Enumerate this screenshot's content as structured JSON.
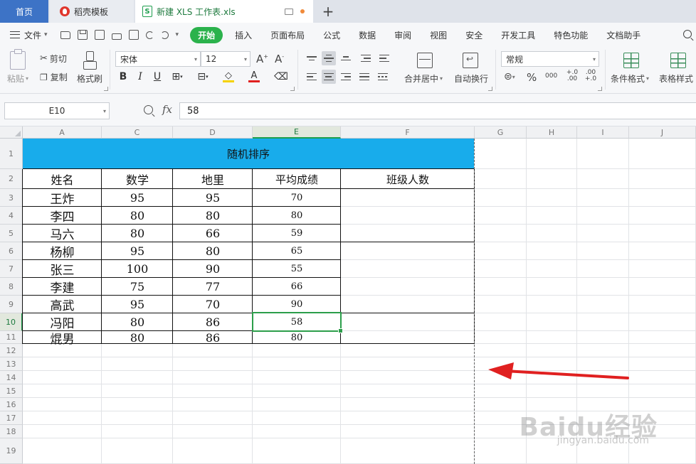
{
  "tabs": {
    "home": "首页",
    "template": "稻壳模板",
    "file": "新建 XLS 工作表.xls",
    "add": "+"
  },
  "menubar": {
    "file_menu": "文件",
    "items": [
      "开始",
      "插入",
      "页面布局",
      "公式",
      "数据",
      "审阅",
      "视图",
      "安全",
      "开发工具",
      "特色功能",
      "文档助手"
    ],
    "active": "开始"
  },
  "ribbon": {
    "paste": "粘贴",
    "cut": "剪切",
    "copy": "复制",
    "format_painter": "格式刷",
    "font_name": "宋体",
    "font_size": "12",
    "bold": "B",
    "italic": "I",
    "underline": "U",
    "merge_center": "合并居中",
    "wrap_text": "自动换行",
    "number_format": "常规",
    "percent": "%",
    "thousands": "000",
    "inc_decimal": "+.0 .00",
    "dec_decimal": ".00 +.0",
    "conditional_format": "条件格式",
    "table_style": "表格样式",
    "font_grow": "A+",
    "font_shrink": "A-"
  },
  "formula_bar": {
    "cell_ref": "E10",
    "fx": "fx",
    "value": "58"
  },
  "grid": {
    "columns": [
      "A",
      "C",
      "D",
      "E",
      "F",
      "G",
      "H",
      "I",
      "J"
    ],
    "rows": [
      "1",
      "2",
      "3",
      "4",
      "5",
      "6",
      "7",
      "8",
      "9",
      "10",
      "11",
      "12",
      "13",
      "14",
      "15",
      "16",
      "17",
      "18",
      "19"
    ],
    "active_column": "E",
    "active_row": "10"
  },
  "table": {
    "title": "随机排序",
    "headers": [
      "姓名",
      "数学",
      "地里",
      "平均成绩",
      "班级人数"
    ],
    "rows": [
      {
        "name": "王炸",
        "math": "95",
        "geo": "95",
        "avg": "70"
      },
      {
        "name": "李四",
        "math": "80",
        "geo": "80",
        "avg": "80"
      },
      {
        "name": "马六",
        "math": "80",
        "geo": "66",
        "avg": "59"
      },
      {
        "name": "杨柳",
        "math": "95",
        "geo": "80",
        "avg": "65"
      },
      {
        "name": "张三",
        "math": "100",
        "geo": "90",
        "avg": "55"
      },
      {
        "name": "李建",
        "math": "75",
        "geo": "77",
        "avg": "66"
      },
      {
        "name": "高武",
        "math": "95",
        "geo": "70",
        "avg": "90"
      },
      {
        "name": "冯阳",
        "math": "80",
        "geo": "86",
        "avg": "58"
      },
      {
        "name": "焜男",
        "math": "80",
        "geo": "86",
        "avg": "80"
      }
    ]
  },
  "watermark": {
    "brand": "Baidu经验",
    "url": "jingyan.baidu.com"
  },
  "colors": {
    "accent_green": "#2bb24c",
    "title_band": "#18aceb",
    "home_tab": "#3d73c6",
    "annotation_arrow": "#e02020"
  }
}
